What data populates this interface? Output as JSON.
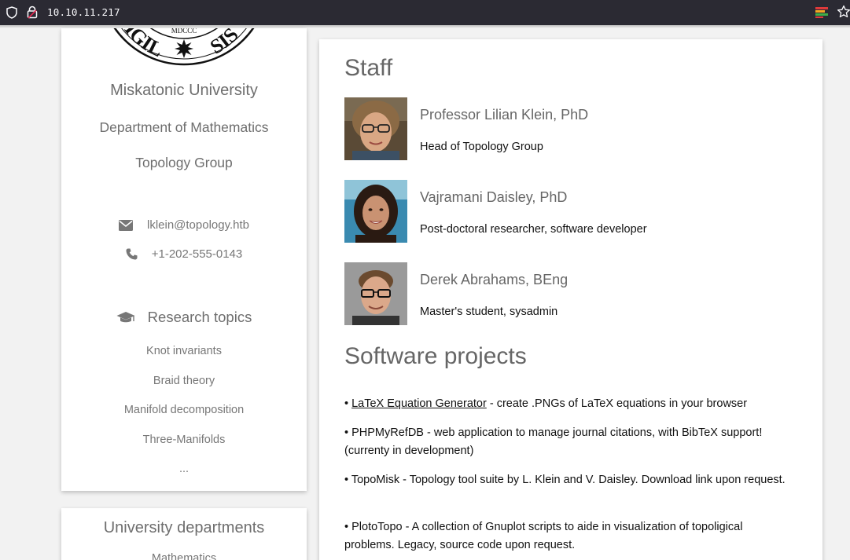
{
  "browser": {
    "url": "10.10.11.217"
  },
  "sidebar": {
    "university": "Miskatonic University",
    "department": "Department of Mathematics",
    "group": "Topology Group",
    "seal": {
      "top_text": "MDCCC",
      "left_text": "SIGIL",
      "right_text": "SIS"
    },
    "email": "lklein@topology.htb",
    "phone": "+1-202-555-0143",
    "research_title": "Research topics",
    "topics": [
      "Knot invariants",
      "Braid theory",
      "Manifold decomposition",
      "Three-Manifolds",
      "..."
    ]
  },
  "departments_card": {
    "title": "University departments",
    "first_item": "Mathematics"
  },
  "main": {
    "staff_title": "Staff",
    "staff": [
      {
        "name": "Professor Lilian Klein, PhD",
        "role": "Head of Topology Group"
      },
      {
        "name": "Vajramani Daisley, PhD",
        "role": "Post-doctoral researcher, software developer"
      },
      {
        "name": "Derek Abrahams, BEng",
        "role": "Master's student, sysadmin"
      }
    ],
    "software_title": "Software projects",
    "projects": [
      {
        "bullet": "•",
        "link": "LaTeX Equation Generator",
        "text": " - create .PNGs of LaTeX equations in your browser"
      },
      {
        "bullet": "•",
        "text": " PHPMyRefDB - web application to manage journal citations, with BibTeX support! (currenty in development)"
      },
      {
        "bullet": "•",
        "text": " TopoMisk - Topology tool suite by L. Klein and V. Daisley. Download link upon request."
      },
      {
        "bullet": "•",
        "text": " PlotoTopo - A collection of Gnuplot scripts to aide in visualization of topoligical problems. Legacy, source code upon request."
      }
    ]
  },
  "colors": {
    "browser_bar": "#2b2a33",
    "page_bg": "#f2f2f2",
    "heading": "#666666",
    "muted": "#777777"
  }
}
